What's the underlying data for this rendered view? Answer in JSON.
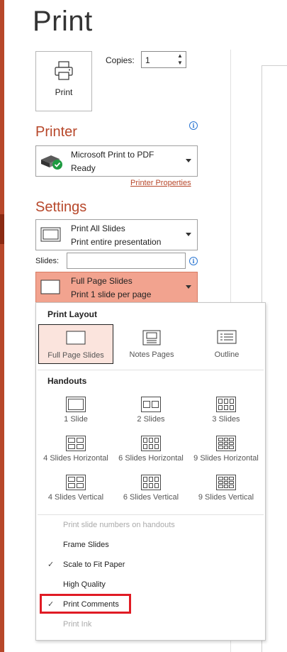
{
  "page": {
    "title": "Print"
  },
  "print_button": {
    "label": "Print",
    "icon": "printer-icon"
  },
  "copies": {
    "label": "Copies:",
    "value": "1"
  },
  "printer": {
    "section_title": "Printer",
    "name": "Microsoft Print to PDF",
    "status": "Ready",
    "properties_link": "Printer Properties",
    "info_icon": "i"
  },
  "settings": {
    "section_title": "Settings",
    "range": {
      "line1": "Print All Slides",
      "line2": "Print entire presentation"
    },
    "slides_label": "Slides:",
    "slides_value": "",
    "info_icon": "i",
    "layout": {
      "line1": "Full Page Slides",
      "line2": "Print 1 slide per page"
    }
  },
  "panel": {
    "print_layout_header": "Print Layout",
    "print_layouts": [
      "Full Page Slides",
      "Notes Pages",
      "Outline"
    ],
    "handouts_header": "Handouts",
    "handouts": [
      "1 Slide",
      "2 Slides",
      "3 Slides",
      "4 Slides Horizontal",
      "6 Slides Horizontal",
      "9 Slides Horizontal",
      "4 Slides Vertical",
      "6 Slides Vertical",
      "9 Slides Vertical"
    ],
    "options": [
      {
        "label": "Print slide numbers on handouts",
        "checked": false,
        "disabled": true
      },
      {
        "label": "Frame Slides",
        "checked": false,
        "disabled": false
      },
      {
        "label": "Scale to Fit Paper",
        "checked": true,
        "disabled": false
      },
      {
        "label": "High Quality",
        "checked": false,
        "disabled": false
      },
      {
        "label": "Print Comments",
        "checked": true,
        "disabled": false
      },
      {
        "label": "Print Ink",
        "checked": false,
        "disabled": true
      }
    ],
    "check_glyph": "✓"
  },
  "colors": {
    "accent": "#b7472a",
    "selected_dropdown": "#f2a38f",
    "highlight": "#e01b24"
  }
}
